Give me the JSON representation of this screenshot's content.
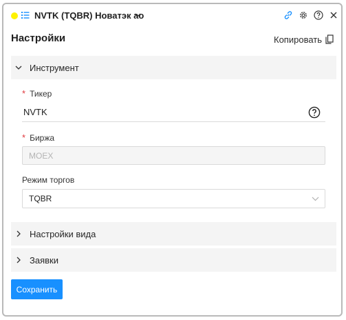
{
  "header": {
    "title": "NVTK (TQBR) Новатэк ао",
    "indicator_color": "#fff200",
    "icons": [
      "list-icon",
      "chevron-down-icon",
      "link-icon",
      "gear-icon",
      "help-icon",
      "close-icon"
    ]
  },
  "settings": {
    "title": "Настройки",
    "copy_label": "Копировать"
  },
  "sections": {
    "instrument": {
      "label": "Инструмент",
      "expanded": true,
      "ticker": {
        "label": "Тикер",
        "required_mark": "*",
        "value": "NVTK"
      },
      "exchange": {
        "label": "Биржа",
        "required_mark": "*",
        "value": "MOEX",
        "disabled": true
      },
      "trade_mode": {
        "label": "Режим торгов",
        "value": "TQBR"
      }
    },
    "view_settings": {
      "label": "Настройки вида",
      "expanded": false
    },
    "orders": {
      "label": "Заявки",
      "expanded": false
    }
  },
  "actions": {
    "save_label": "Сохранить",
    "primary_color": "#1890ff"
  }
}
